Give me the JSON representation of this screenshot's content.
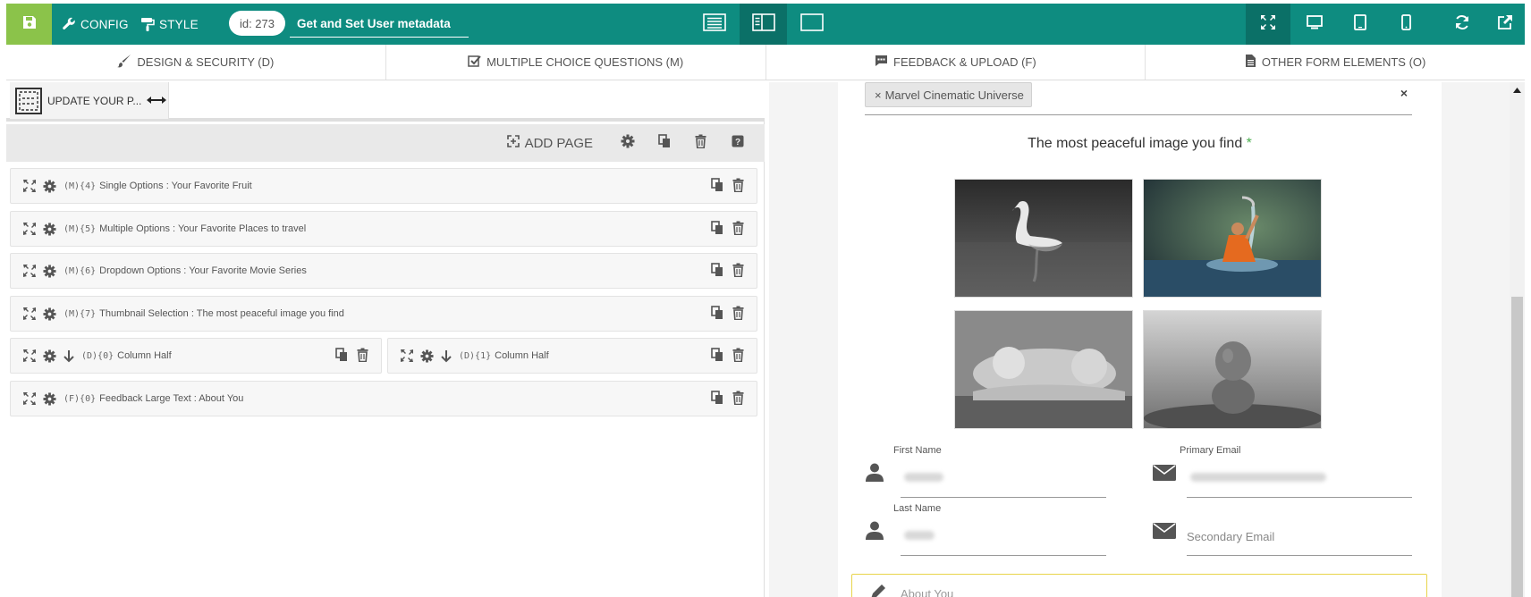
{
  "toolbar": {
    "config_label": "CONFIG",
    "style_label": "STYLE",
    "id_label": "id: 273",
    "form_title": "Get and Set User metadata",
    "colors": {
      "bar": "#0e8c80",
      "save": "#8bc34a",
      "active": "#0b7067"
    }
  },
  "tabs": [
    {
      "label": "DESIGN & SECURITY (D)",
      "icon": "brush-icon"
    },
    {
      "label": "MULTIPLE CHOICE QUESTIONS (M)",
      "icon": "checkbox-icon"
    },
    {
      "label": "FEEDBACK & UPLOAD (F)",
      "icon": "comment-icon"
    },
    {
      "label": "OTHER FORM ELEMENTS (O)",
      "icon": "document-icon"
    }
  ],
  "page": {
    "tab_label": "UPDATE YOUR P...",
    "add_page_label": "ADD PAGE"
  },
  "elements": [
    {
      "code": "(M){4}",
      "label": "Single Options : Your Favorite Fruit"
    },
    {
      "code": "(M){5}",
      "label": "Multiple Options : Your Favorite Places to travel"
    },
    {
      "code": "(M){6}",
      "label": "Dropdown Options : Your Favorite Movie Series"
    },
    {
      "code": "(M){7}",
      "label": "Thumbnail Selection : The most peaceful image you find"
    },
    {
      "code": "(D){0}",
      "label": "Column Half"
    },
    {
      "code": "(D){1}",
      "label": "Column Half"
    },
    {
      "code": "(F){0}",
      "label": "Feedback Large Text : About You"
    }
  ],
  "preview": {
    "selected_tag": "Marvel Cinematic Universe",
    "tag_remove": "×",
    "clear_all": "×",
    "question": "The most peaceful image you find",
    "required_mark": "*",
    "images": [
      "swan-image",
      "monk-water-image",
      "sleeping-baby-image",
      "stacked-stones-image"
    ],
    "first_name_label": "First Name",
    "last_name_label": "Last Name",
    "primary_email_label": "Primary Email",
    "secondary_email_placeholder": "Secondary Email",
    "about_placeholder": "About You"
  }
}
